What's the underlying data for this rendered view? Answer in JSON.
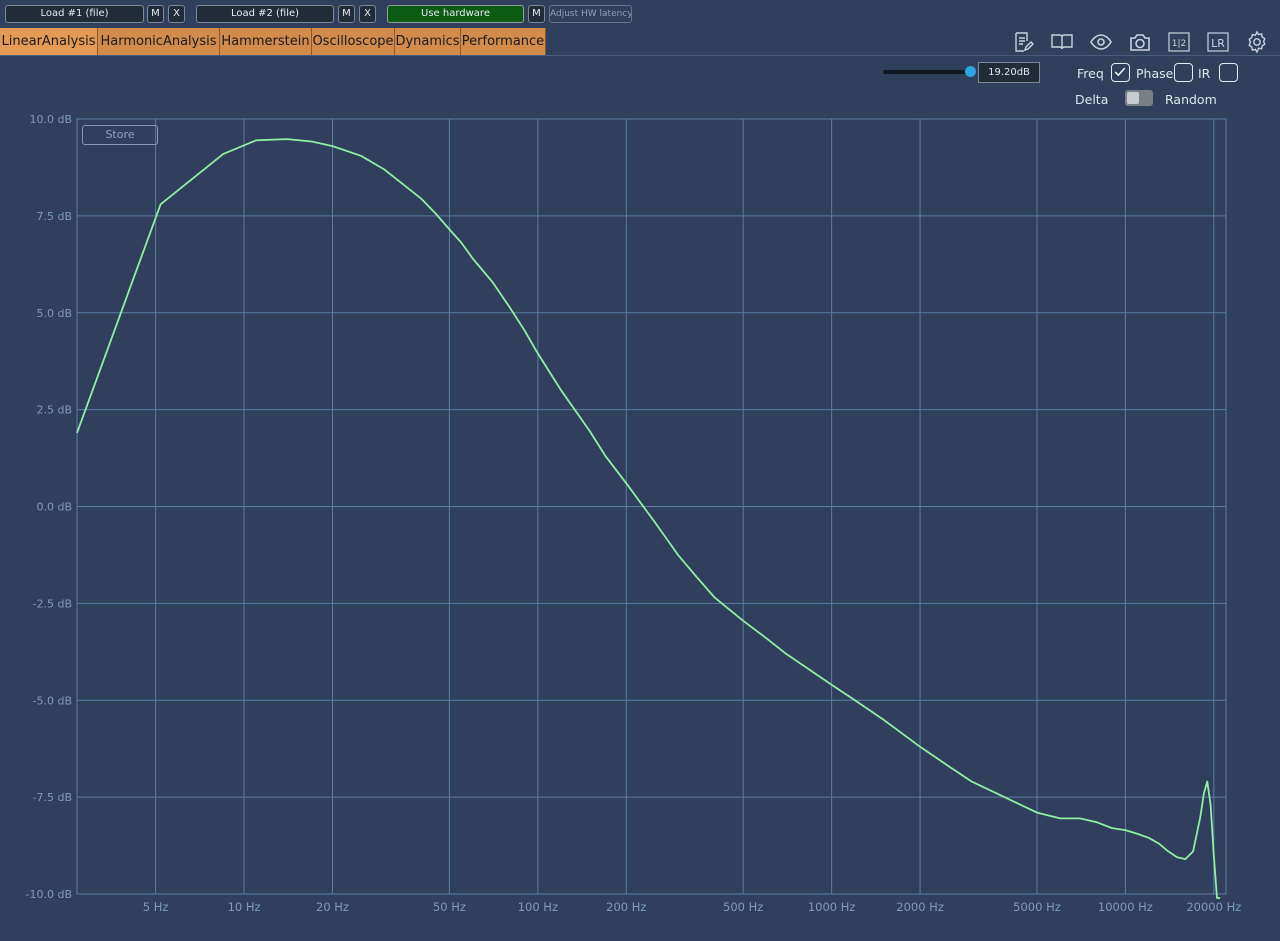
{
  "toolbar": {
    "load1_label": "Load #1 (file)",
    "load2_label": "Load #2 (file)",
    "m_label": "M",
    "x_label": "X",
    "use_hardware_label": "Use hardware",
    "adjust_latency_label": "Adjust HW latency"
  },
  "tabs": [
    {
      "label": "LinearAnalysis",
      "active": true
    },
    {
      "label": "HarmonicAnalysis"
    },
    {
      "label": "Hammerstein"
    },
    {
      "label": "Oscilloscope"
    },
    {
      "label": "Dynamics"
    },
    {
      "label": "Performance"
    }
  ],
  "top_icons": [
    "notes-icon",
    "book-icon",
    "eye-icon",
    "camera-icon",
    "half-compare-icon",
    "lr-icon",
    "gear-icon"
  ],
  "top_icon_text": {
    "half": "1|2",
    "lr": "LR"
  },
  "controls": {
    "range_value": "19.20dB",
    "range_slider_fraction": 1.0,
    "freq_label": "Freq",
    "freq_checked": true,
    "phase_label": "Phase",
    "phase_checked": false,
    "ir_label": "IR",
    "ir_checked": false,
    "delta_label": "Delta",
    "random_label": "Random",
    "delta_random_toggle": "Delta"
  },
  "store_label": "Store",
  "colors": {
    "background": "#2f3f5c",
    "grid": "#5b7ea6",
    "curve": "#8ff0a4",
    "tab": "#d18b4b",
    "hardware_button": "#0d5a12",
    "slider_knob": "#2aa6e0"
  },
  "chart_data": {
    "type": "line",
    "xscale": "log",
    "xlim": [
      2.7,
      22000
    ],
    "ylim": [
      -10,
      10
    ],
    "grid": true,
    "x_ticks": [
      5,
      10,
      20,
      50,
      100,
      200,
      500,
      1000,
      2000,
      5000,
      10000,
      20000
    ],
    "x_tick_labels": [
      "5 Hz",
      "10 Hz",
      "20 Hz",
      "50 Hz",
      "100 Hz",
      "200 Hz",
      "500 Hz",
      "1000 Hz",
      "2000 Hz",
      "5000 Hz",
      "10000 Hz",
      "20000 Hz"
    ],
    "y_ticks": [
      10,
      7.5,
      5,
      2.5,
      0,
      -2.5,
      -5,
      -7.5,
      -10
    ],
    "y_tick_labels": [
      "10.0 dB",
      "7.5 dB",
      "5.0 dB",
      "2.5 dB",
      "0.0 dB",
      "-2.5 dB",
      "-5.0 dB",
      "-7.5 dB",
      "-10.0 dB"
    ],
    "series": [
      {
        "x": [
          2.7,
          5.2,
          8.5,
          11,
          14,
          17,
          20,
          25,
          30,
          35,
          40,
          45,
          50,
          55,
          60,
          70,
          80,
          90,
          100,
          120,
          150,
          170,
          200,
          250,
          300,
          350,
          400,
          500,
          600,
          700,
          800,
          1000,
          1200,
          1500,
          2000,
          2500,
          3000,
          4000,
          5000,
          6000,
          7000,
          8000,
          9000,
          10000,
          11000,
          12000,
          13000,
          14000,
          15000,
          16000,
          17000,
          18000,
          18500,
          19000,
          19500,
          20000,
          20500,
          21000
        ],
        "y": [
          1.9,
          7.8,
          9.1,
          9.45,
          9.48,
          9.42,
          9.3,
          9.05,
          8.7,
          8.3,
          7.95,
          7.55,
          7.15,
          6.8,
          6.4,
          5.8,
          5.15,
          4.55,
          3.95,
          3.0,
          1.95,
          1.3,
          0.6,
          -0.4,
          -1.25,
          -1.85,
          -2.35,
          -2.95,
          -3.4,
          -3.8,
          -4.1,
          -4.6,
          -5.0,
          -5.5,
          -6.2,
          -6.7,
          -7.1,
          -7.55,
          -7.9,
          -8.05,
          -8.05,
          -8.15,
          -8.3,
          -8.35,
          -8.45,
          -8.55,
          -8.7,
          -8.9,
          -9.05,
          -9.1,
          -8.9,
          -8.0,
          -7.4,
          -7.1,
          -7.7,
          -9.0,
          -10.2,
          -10.5
        ]
      }
    ]
  }
}
